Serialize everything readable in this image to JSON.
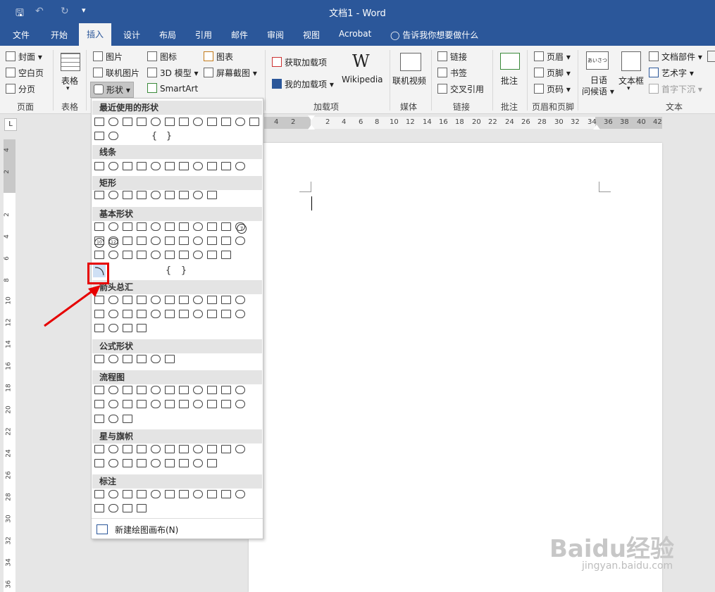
{
  "window": {
    "title": "文档1  -  Word"
  },
  "quick_access": {
    "save": "save-icon",
    "undo": "undo-icon",
    "redo": "redo-icon",
    "customize": "customize-icon"
  },
  "tabs": [
    "文件",
    "开始",
    "插入",
    "设计",
    "布局",
    "引用",
    "邮件",
    "审阅",
    "视图",
    "Acrobat"
  ],
  "tell_me": "告诉我你想要做什么",
  "ribbon": {
    "pages": {
      "cover": "封面",
      "blank": "空白页",
      "break": "分页",
      "group": "页面"
    },
    "table": {
      "label": "表格",
      "group": "表格"
    },
    "illustrations": {
      "pictures": "图片",
      "online_pictures": "联机图片",
      "shapes": "形状",
      "icons": "图标",
      "models3d": "3D 模型",
      "smartart": "SmartArt",
      "chart": "图表",
      "screenshot": "屏幕截图"
    },
    "addins": {
      "get": "获取加载项",
      "mine": "我的加载项",
      "wikipedia": "Wikipedia",
      "group": "加载项"
    },
    "media": {
      "video": "联机视频",
      "group": "媒体"
    },
    "links": {
      "link": "链接",
      "bookmark": "书签",
      "crossref": "交叉引用",
      "group": "链接"
    },
    "comments": {
      "comment": "批注",
      "group": "批注"
    },
    "header_footer": {
      "header": "页眉",
      "footer": "页脚",
      "page_number": "页码",
      "group": "页眉和页脚"
    },
    "text": {
      "greeting_line1": "日语",
      "greeting_line2": "问候语",
      "textbox": "文本框",
      "quick_parts": "文档部件",
      "wordart": "艺术字",
      "dropcap": "首字下沉",
      "group": "文本",
      "greeting_icon_text": "あいさつ"
    }
  },
  "ruler": {
    "h_left": [
      "4",
      "2"
    ],
    "h_right": [
      "2",
      "4",
      "6",
      "8",
      "10",
      "12",
      "14",
      "16",
      "18",
      "20",
      "22",
      "24",
      "26",
      "28",
      "30",
      "32",
      "34",
      "36",
      "38",
      "40",
      "42"
    ],
    "v": [
      "4",
      "2",
      "2",
      "4",
      "6",
      "8",
      "10",
      "12",
      "14",
      "16",
      "18",
      "20",
      "22",
      "24",
      "26",
      "28",
      "30",
      "32",
      "34",
      "36"
    ],
    "tab_selector": "L"
  },
  "shapes_menu": {
    "categories": [
      "最近使用的形状",
      "线条",
      "矩形",
      "基本形状",
      "箭头总汇",
      "公式形状",
      "流程图",
      "星与旗帜",
      "标注"
    ],
    "new_canvas": "新建绘图画布(N)",
    "recent_row2_text": [
      "{",
      "}"
    ],
    "basic_text": [
      "{",
      "}"
    ],
    "basic_nums": [
      "7",
      "10",
      "12"
    ],
    "selected_shape": "arc-shape"
  },
  "watermark": {
    "logo": "Baidu经验",
    "url": "jingyan.baidu.com"
  },
  "colors": {
    "brand": "#2b579a",
    "highlight": "#e60000"
  }
}
